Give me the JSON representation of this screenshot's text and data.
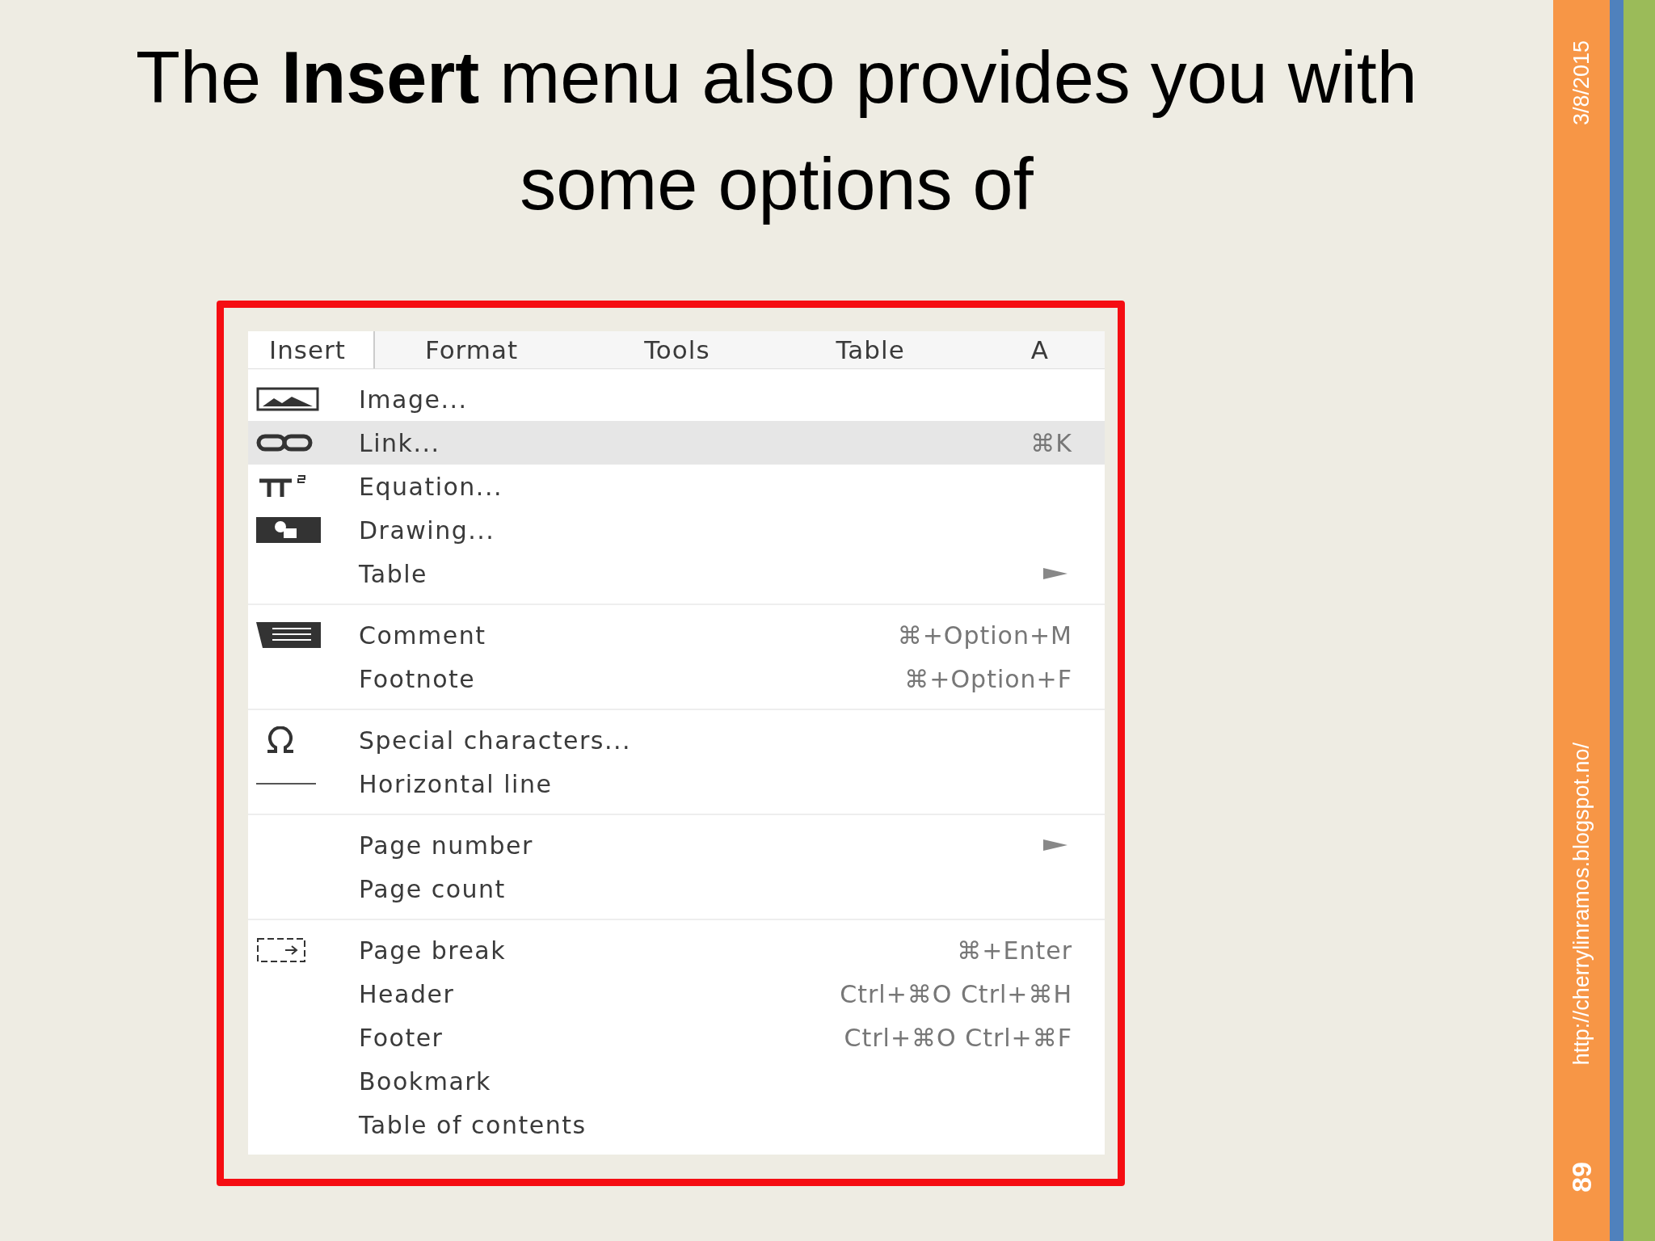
{
  "slide": {
    "title": "The **Insert** menu also provides you with some options of",
    "date": "3/8/2015",
    "url": "http://cherrylinramos.blogspot.no/",
    "page_number": "89"
  },
  "menu_bar": [
    {
      "label": "Insert",
      "selected": true
    },
    {
      "label": "Format",
      "selected": false
    },
    {
      "label": "Tools",
      "selected": false
    },
    {
      "label": "Table",
      "selected": false
    },
    {
      "label": "A",
      "selected": false
    }
  ],
  "menu_groups": [
    {
      "items": [
        {
          "label": "Image...",
          "kind": "image",
          "highlighted": false
        },
        {
          "label": "Link...",
          "kind": "link",
          "shortcut": "⌘K",
          "highlighted": true
        },
        {
          "label": "Equation...",
          "kind": "equation",
          "highlighted": false
        },
        {
          "label": "Drawing...",
          "kind": "drawing",
          "highlighted": false
        },
        {
          "label": "Table",
          "submenu": true,
          "highlighted": false
        }
      ]
    },
    {
      "items": [
        {
          "label": "Comment",
          "kind": "comment",
          "shortcut": "⌘+Option+M",
          "highlighted": false
        },
        {
          "label": "Footnote",
          "shortcut": "⌘+Option+F",
          "highlighted": false
        }
      ]
    },
    {
      "items": [
        {
          "label": "Special characters...",
          "kind": "omega",
          "highlighted": false
        },
        {
          "label": "Horizontal line",
          "kind": "hline",
          "highlighted": false
        }
      ]
    },
    {
      "items": [
        {
          "label": "Page number",
          "submenu": true,
          "highlighted": false
        },
        {
          "label": "Page count",
          "highlighted": false
        }
      ]
    },
    {
      "items": [
        {
          "label": "Page break",
          "kind": "pagebreak",
          "shortcut": "⌘+Enter",
          "highlighted": false
        },
        {
          "label": "Header",
          "shortcut": "Ctrl+⌘O Ctrl+⌘H",
          "highlighted": false
        },
        {
          "label": "Footer",
          "shortcut": "Ctrl+⌘O Ctrl+⌘F",
          "highlighted": false
        },
        {
          "label": "Bookmark",
          "highlighted": false
        },
        {
          "label": "Table of contents",
          "highlighted": false
        }
      ]
    }
  ]
}
